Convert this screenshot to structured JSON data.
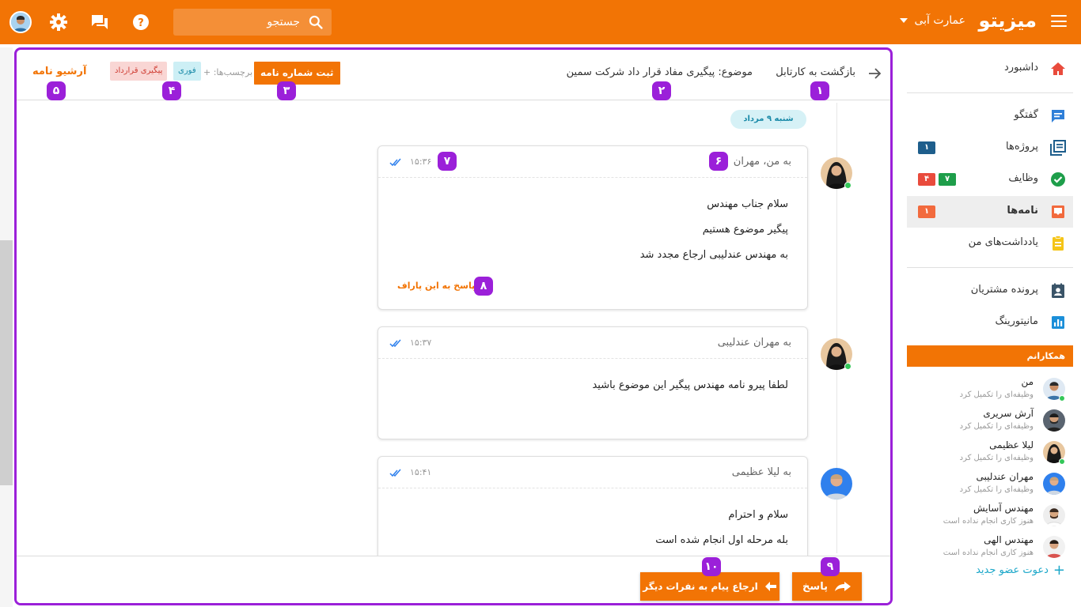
{
  "topbar": {
    "brand": "میزیتو",
    "building": "عمارت آبی",
    "search_placeholder": "جستجو"
  },
  "colors": {
    "primary": "#f27405",
    "annotation": "#9b20d9",
    "info": "#1ba7c9",
    "badge_blue": "#1e5e8c",
    "badge_red": "#e94b3c",
    "badge_green": "#1e9e4a",
    "badge_orange": "#f26a3d"
  },
  "sidebar": {
    "items": [
      {
        "label": "داشبورد",
        "icon": "home-icon"
      },
      {
        "label": "گفتگو",
        "icon": "chat-icon"
      },
      {
        "label": "پروژه‌ها",
        "icon": "projects-icon",
        "badges": [
          "۱"
        ]
      },
      {
        "label": "وظایف",
        "icon": "check-circle-icon",
        "badges": [
          "۷",
          "۴"
        ]
      },
      {
        "label": "نامه‌ها",
        "icon": "letter-icon",
        "badges": [
          "۱"
        ],
        "active": true
      },
      {
        "label": "یادداشت‌های من",
        "icon": "note-icon"
      },
      {
        "label": "پرونده مشتریان",
        "icon": "contacts-icon"
      },
      {
        "label": "مانیتورینگ",
        "icon": "chart-icon"
      }
    ],
    "colleagues_title": "همکارانم",
    "colleagues": [
      {
        "name": "من",
        "status": "وظیفه‌ای را تکمیل کرد",
        "online": true
      },
      {
        "name": "آرش سریری",
        "status": "وظیفه‌ای را تکمیل کرد",
        "online": false
      },
      {
        "name": "لیلا عظیمی",
        "status": "وظیفه‌ای را تکمیل کرد",
        "online": true
      },
      {
        "name": "مهران عندلیبی",
        "status": "وظیفه‌ای را تکمیل کرد",
        "online": false
      },
      {
        "name": "مهندس آسایش",
        "status": "هنوز کاری انجام نداده است",
        "online": false
      },
      {
        "name": "مهندس الهی",
        "status": "هنوز کاری انجام نداده است",
        "online": false
      }
    ],
    "invite": "دعوت عضو جدید"
  },
  "header": {
    "back": "بازگشت به کارتابل",
    "subject": "موضوع: پیگیری مفاد قرار داد شرکت سمین",
    "register_button": "ثبت شماره نامه",
    "tags_label": "برچسب‌ها: +",
    "tags": [
      "فوری",
      "پیگیری قرارداد"
    ],
    "archive": "آرشیو نامه"
  },
  "markers": [
    "۱",
    "۲",
    "۳",
    "۴",
    "۵",
    "۶",
    "۷",
    "۸",
    "۹",
    "۱۰"
  ],
  "date_pill": "شنبه ۹ مرداد",
  "messages": [
    {
      "to": "به من، مهران",
      "time": "۱۵:۳۶",
      "lines": [
        "سلام جناب مهندس",
        "پیگیر موضوع هستیم",
        "به مهندس عندلیبی ارجاع مجدد شد"
      ],
      "reply_para": "پاسخ به این پاراف"
    },
    {
      "to": "به مهران عندلیبی",
      "time": "۱۵:۳۷",
      "lines": [
        "لطفا پیرو نامه مهندس پیگیر این موضوع باشید"
      ]
    },
    {
      "to": "به لیلا عظیمی",
      "time": "۱۵:۴۱",
      "lines": [
        "سلام و احترام",
        "بله مرحله اول انجام شده است"
      ]
    }
  ],
  "footer": {
    "answer": "پاسخ",
    "forward": "ارجاع پیام به نفرات دیگر"
  }
}
